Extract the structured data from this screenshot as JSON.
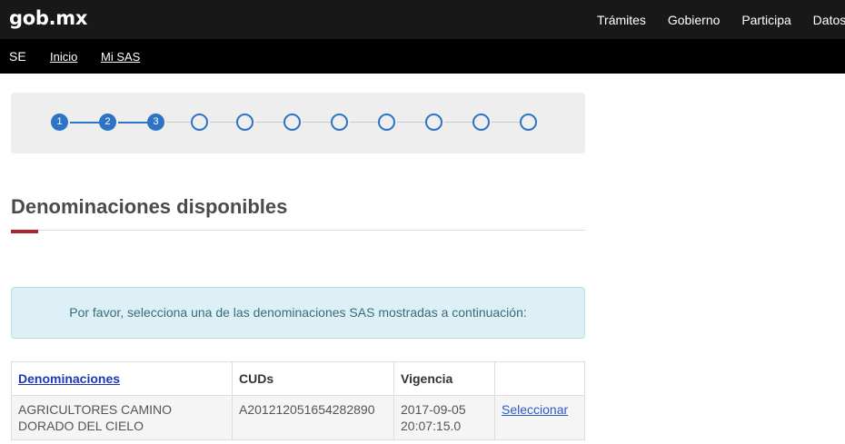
{
  "header": {
    "logo": "gob.mx",
    "nav": [
      "Trámites",
      "Gobierno",
      "Participa",
      "Datos"
    ]
  },
  "subnav": {
    "section": "SE",
    "links": [
      "Inicio",
      "Mi SAS"
    ]
  },
  "stepper": {
    "total_steps": 11,
    "completed_steps": 3,
    "labels": [
      "1",
      "2",
      "3"
    ]
  },
  "main": {
    "title": "Denominaciones disponibles",
    "alert": "Por favor, selecciona una de las denominaciones SAS mostradas a continuación:"
  },
  "table": {
    "headers": [
      "Denominaciones",
      "CUDs",
      "Vigencia",
      ""
    ],
    "rows": [
      {
        "denominacion": "AGRICULTORES CAMINO DORADO DEL CIELO",
        "cud": "A201212051654282890",
        "vigencia": "2017-09-05 20:07:15.0",
        "action": "Seleccionar"
      }
    ]
  },
  "colors": {
    "step_blue": "#2e74c6",
    "accent_red": "#b1212e",
    "alert_bg": "#dcf0f6"
  }
}
